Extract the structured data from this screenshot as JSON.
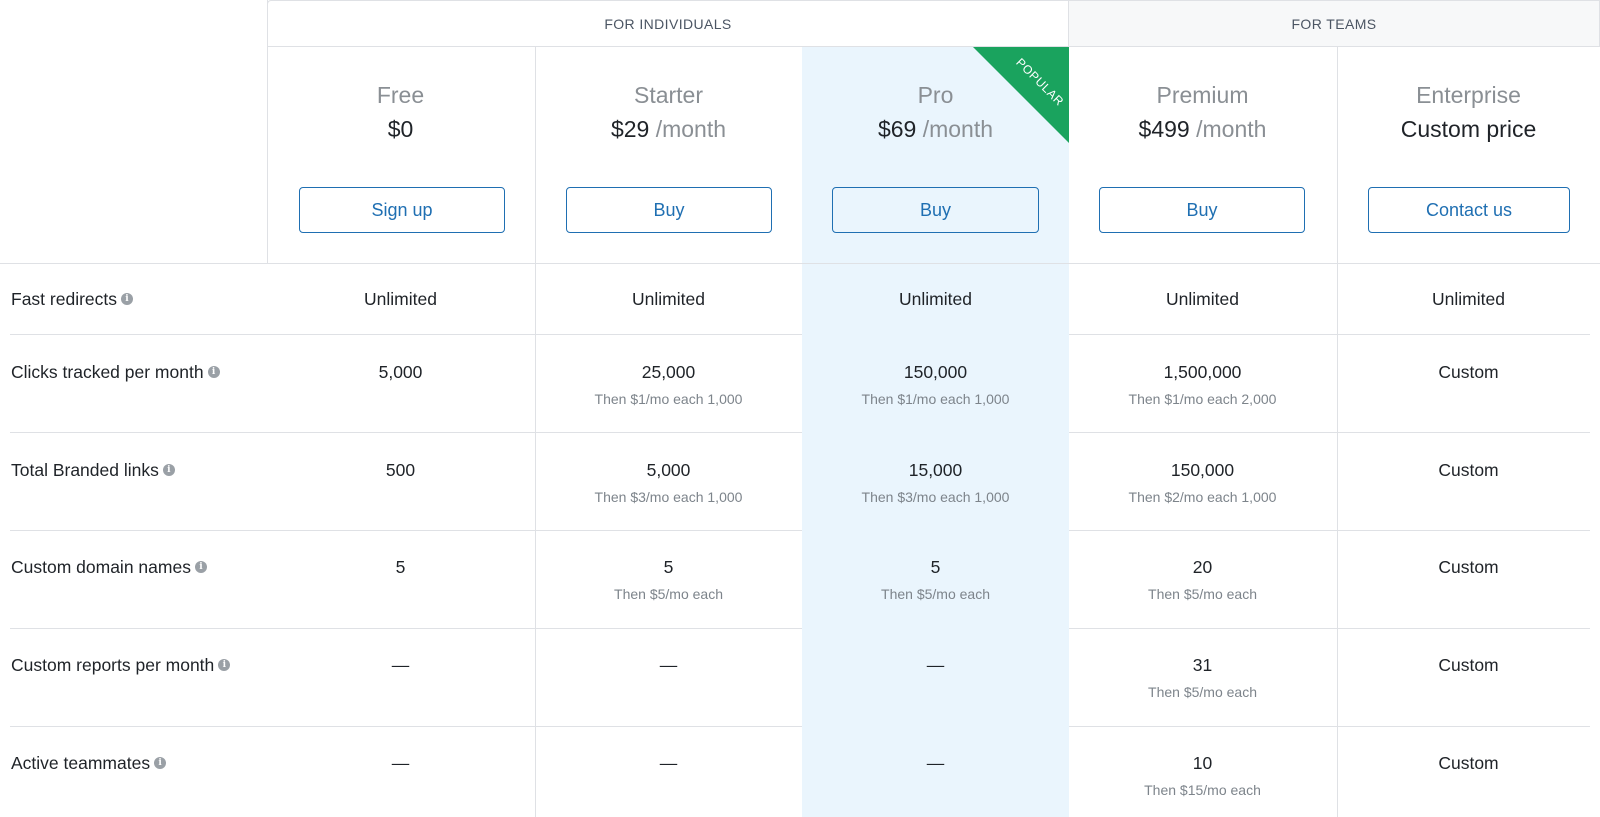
{
  "groups": {
    "individuals": "FOR INDIVIDUALS",
    "teams": "FOR TEAMS"
  },
  "plans": [
    {
      "name": "Free",
      "price": "$0",
      "period": "",
      "button": "Sign up"
    },
    {
      "name": "Starter",
      "price": "$29",
      "period": "/month",
      "button": "Buy"
    },
    {
      "name": "Pro",
      "price": "$69",
      "period": "/month",
      "button": "Buy",
      "badge": "POPULAR"
    },
    {
      "name": "Premium",
      "price": "$499",
      "period": "/month",
      "button": "Buy"
    },
    {
      "name": "Enterprise",
      "price": "Custom price",
      "period": "",
      "button": "Contact us"
    }
  ],
  "info_glyph": "i",
  "features": [
    {
      "label": "Fast redirects",
      "cells": [
        {
          "main": "Unlimited",
          "sub": ""
        },
        {
          "main": "Unlimited",
          "sub": ""
        },
        {
          "main": "Unlimited",
          "sub": ""
        },
        {
          "main": "Unlimited",
          "sub": ""
        },
        {
          "main": "Unlimited",
          "sub": ""
        }
      ]
    },
    {
      "label": "Clicks tracked per month",
      "cells": [
        {
          "main": "5,000",
          "sub": ""
        },
        {
          "main": "25,000",
          "sub": "Then $1/mo each 1,000"
        },
        {
          "main": "150,000",
          "sub": "Then $1/mo each 1,000"
        },
        {
          "main": "1,500,000",
          "sub": "Then $1/mo each 2,000"
        },
        {
          "main": "Custom",
          "sub": ""
        }
      ]
    },
    {
      "label": "Total Branded links",
      "cells": [
        {
          "main": "500",
          "sub": ""
        },
        {
          "main": "5,000",
          "sub": "Then $3/mo each 1,000"
        },
        {
          "main": "15,000",
          "sub": "Then $3/mo each 1,000"
        },
        {
          "main": "150,000",
          "sub": "Then $2/mo each 1,000"
        },
        {
          "main": "Custom",
          "sub": ""
        }
      ]
    },
    {
      "label": "Custom domain names",
      "cells": [
        {
          "main": "5",
          "sub": ""
        },
        {
          "main": "5",
          "sub": "Then $5/mo each"
        },
        {
          "main": "5",
          "sub": "Then $5/mo each"
        },
        {
          "main": "20",
          "sub": "Then $5/mo each"
        },
        {
          "main": "Custom",
          "sub": ""
        }
      ]
    },
    {
      "label": "Custom reports per month",
      "cells": [
        {
          "main": "—",
          "sub": ""
        },
        {
          "main": "—",
          "sub": ""
        },
        {
          "main": "—",
          "sub": ""
        },
        {
          "main": "31",
          "sub": "Then $5/mo each"
        },
        {
          "main": "Custom",
          "sub": ""
        }
      ]
    },
    {
      "label": "Active teammates",
      "cells": [
        {
          "main": "—",
          "sub": ""
        },
        {
          "main": "—",
          "sub": ""
        },
        {
          "main": "—",
          "sub": ""
        },
        {
          "main": "10",
          "sub": "Then $15/mo each"
        },
        {
          "main": "Custom",
          "sub": ""
        }
      ]
    }
  ],
  "colors": {
    "accent": "#1f6fb2",
    "popular_badge": "#1aa35e",
    "highlight_column": "#eaf5fd",
    "divider": "#dfe1e5"
  }
}
